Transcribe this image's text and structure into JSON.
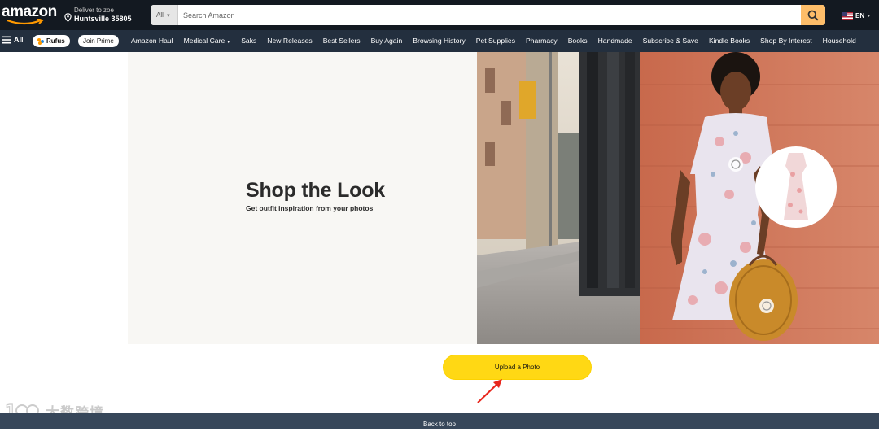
{
  "header": {
    "logo_text": "amazon",
    "deliver_line1": "Deliver to zoe",
    "deliver_line2": "Huntsville 35805",
    "search_category": "All",
    "search_placeholder": "Search Amazon",
    "language": "EN"
  },
  "nav": {
    "all_label": "All",
    "rufus_label": "Rufus",
    "join_prime_label": "Join Prime",
    "links": [
      "Amazon Haul",
      "Medical Care",
      "Saks",
      "New Releases",
      "Best Sellers",
      "Buy Again",
      "Browsing History",
      "Pet Supplies",
      "Pharmacy",
      "Books",
      "Handmade",
      "Subscribe & Save",
      "Kindle Books",
      "Shop By Interest",
      "Household"
    ]
  },
  "hero": {
    "title": "Shop the Look",
    "subtitle": "Get outfit inspiration from your photos"
  },
  "upload_label": "Upload a Photo",
  "watermark_text": "大数跨境",
  "back_to_top": "Back to top",
  "colors": {
    "header_bg": "#131921",
    "nav_bg": "#232f3e",
    "search_button": "#febd69",
    "upload_button": "#ffd814",
    "footer_bg": "#37475a",
    "arrow": "#e8261c"
  }
}
